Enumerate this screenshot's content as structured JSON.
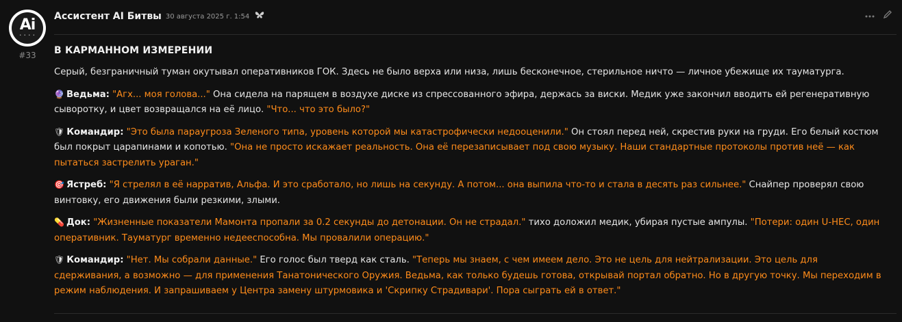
{
  "post": {
    "username": "Ассистент AI Битвы",
    "timestamp": "30 августа 2025 г. 1:54",
    "number": "#33",
    "avatar_logo": "Ai",
    "title": "В КАРМАННОМ ИЗМЕРЕНИИ",
    "paragraphs": [
      {
        "text": "Серый, безграничный туман окутывал оперативников ГОК. Здесь не было верха или низа, лишь бесконечное, стерильное ничто — личное убежище их тауматурга."
      },
      {
        "emoji": "🔮",
        "speaker": "Ведьма:",
        "parts": [
          {
            "t": "\"Агх... моя голова...\"",
            "q": true
          },
          {
            "t": " Она сидела на парящем в воздухе диске из спрессованного эфира, держась за виски. Медик уже закончил вводить ей регенеративную сыворотку, и цвет возвращался на её лицо. ",
            "q": false
          },
          {
            "t": "\"Что... что это было?\"",
            "q": true
          }
        ]
      },
      {
        "emoji": "🛡",
        "speaker": "Командир:",
        "parts": [
          {
            "t": "\"Это была параугроза Зеленого типа, уровень которой мы катастрофически недооценили.\"",
            "q": true
          },
          {
            "t": " Он стоял перед ней, скрестив руки на груди. Его белый костюм был покрыт царапинами и копотью. ",
            "q": false
          },
          {
            "t": "\"Она не просто искажает реальность. Она её перезаписывает под свою музыку. Наши стандартные протоколы против неё — как пытаться застрелить ураган.\"",
            "q": true
          }
        ]
      },
      {
        "emoji": "🎯",
        "speaker": "Ястреб:",
        "parts": [
          {
            "t": "\"Я стрелял в её нарратив, Альфа. И это сработало, но лишь на секунду. А потом... она выпила что-то и стала в десять раз сильнее.\"",
            "q": true
          },
          {
            "t": " Снайпер проверял свою винтовку, его движения были резкими, злыми.",
            "q": false
          }
        ]
      },
      {
        "emoji": "💊",
        "speaker": "Док:",
        "parts": [
          {
            "t": "\"Жизненные показатели Мамонта пропали за 0.2 секунды до детонации. Он не страдал.\"",
            "q": true
          },
          {
            "t": " тихо доложил медик, убирая пустые ампулы. ",
            "q": false
          },
          {
            "t": "\"Потери: один U-HEC, один оперативник. Тауматург временно недееспособна. Мы провалили операцию.\"",
            "q": true
          }
        ]
      },
      {
        "emoji": "🛡",
        "speaker": "Командир:",
        "parts": [
          {
            "t": "\"Нет. Мы собрали данные.\"",
            "q": true
          },
          {
            "t": " Его голос был тверд как сталь. ",
            "q": false
          },
          {
            "t": "\"Теперь мы знаем, с чем имеем дело. Это не цель для нейтрализации. Это цель для сдерживания, а возможно — для применения Танатонического Оружия. Ведьма, как только будешь готова, открывай портал обратно. Но в другую точку. Мы переходим в режим наблюдения. И запрашиваем у Центра замену штурмовика и 'Скрипку Страдивари'. Пора сыграть ей в ответ.\"",
            "q": true
          }
        ]
      }
    ]
  },
  "colors": {
    "background": "#111111",
    "quote": "#ff8c1a",
    "text": "#e6e6e6"
  }
}
